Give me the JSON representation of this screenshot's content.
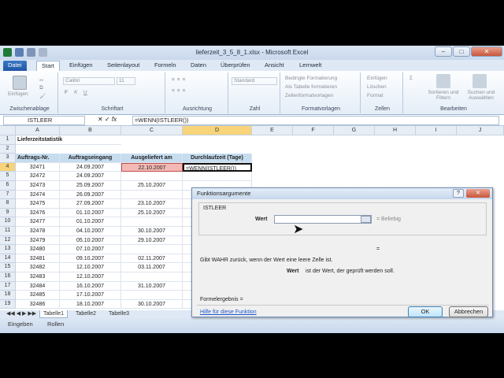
{
  "window_title": "lieferzeit_3_5_8_1.xlsx - Microsoft Excel",
  "ribbon_tabs": [
    "Datei",
    "Start",
    "Einfügen",
    "Seitenlayout",
    "Formeln",
    "Daten",
    "Überprüfen",
    "Ansicht",
    "Lernwelt"
  ],
  "ribbon": {
    "clipboard": {
      "paste": "Einfügen",
      "label": "Zwischenablage"
    },
    "font": {
      "name": "Calibri",
      "size": "11",
      "label": "Schriftart",
      "bold": "F",
      "italic": "K",
      "underline": "U"
    },
    "alignment": {
      "label": "Ausrichtung"
    },
    "number": {
      "format": "Standard",
      "label": "Zahl"
    },
    "styles": {
      "cond": "Bedingte Formatierung",
      "table": "Als Tabelle formatieren",
      "cell": "Zellenformatvorlagen",
      "label": "Formatvorlagen"
    },
    "cells": {
      "insert": "Einfügen",
      "delete": "Löschen",
      "format": "Format",
      "label": "Zellen"
    },
    "editing": {
      "sort": "Sortieren und Filtern",
      "find": "Suchen und Auswählen",
      "label": "Bearbeiten"
    }
  },
  "formula_bar": {
    "name_box": "ISTLEER",
    "formula": "=WENN(ISTLEER())"
  },
  "columns": [
    "A",
    "B",
    "C",
    "D",
    "E",
    "F",
    "G",
    "H",
    "I",
    "J"
  ],
  "sheet": {
    "title": "Lieferzeitstatistik",
    "headers": [
      "Auftrags-Nr.",
      "Auftragseingang",
      "Ausgeliefert am",
      "Durchlaufzeit (Tage)"
    ],
    "rows": [
      [
        "32471",
        "24.09.2007",
        "22.10.2007",
        "=WENN(ISTLEER())"
      ],
      [
        "32472",
        "24.09.2007",
        "",
        ""
      ],
      [
        "32473",
        "25.09.2007",
        "25.10.2007",
        ""
      ],
      [
        "32474",
        "26.09.2007",
        "",
        ""
      ],
      [
        "32475",
        "27.09.2007",
        "23.10.2007",
        ""
      ],
      [
        "32476",
        "01.10.2007",
        "25.10.2007",
        ""
      ],
      [
        "32477",
        "01.10.2007",
        "",
        ""
      ],
      [
        "32478",
        "04.10.2007",
        "30.10.2007",
        ""
      ],
      [
        "32479",
        "05.10.2007",
        "29.10.2007",
        ""
      ],
      [
        "32480",
        "07.10.2007",
        "",
        ""
      ],
      [
        "32481",
        "09.10.2007",
        "02.11.2007",
        ""
      ],
      [
        "32482",
        "12.10.2007",
        "03.11.2007",
        ""
      ],
      [
        "32483",
        "12.10.2007",
        "",
        ""
      ],
      [
        "32484",
        "16.10.2007",
        "31.10.2007",
        ""
      ],
      [
        "32485",
        "17.10.2007",
        "",
        ""
      ],
      [
        "32486",
        "18.10.2007",
        "30.10.2007",
        ""
      ]
    ]
  },
  "row_numbers": [
    "1",
    "2",
    "3",
    "4",
    "5",
    "6",
    "7",
    "8",
    "9",
    "10",
    "11",
    "12",
    "13",
    "14",
    "15",
    "16",
    "17",
    "18",
    "19"
  ],
  "sheet_tabs": [
    "Tabelle1",
    "Tabelle2",
    "Tabelle3"
  ],
  "status": {
    "mode": "Eingeben",
    "scroll": "Rollen"
  },
  "dialog": {
    "title": "Funktionsargumente",
    "function": "ISTLEER",
    "arg_label": "Wert",
    "arg_value": "",
    "arg_result": "= Beliebig",
    "eq": "=",
    "description": "Gibt WAHR zurück, wenn der Wert eine leere Zelle ist.",
    "arg_desc_name": "Wert",
    "arg_desc": "ist der Wert, der geprüft werden soll.",
    "result_label": "Formelergebnis =",
    "help_link": "Hilfe für diese Funktion",
    "ok": "OK",
    "cancel": "Abbrechen"
  }
}
